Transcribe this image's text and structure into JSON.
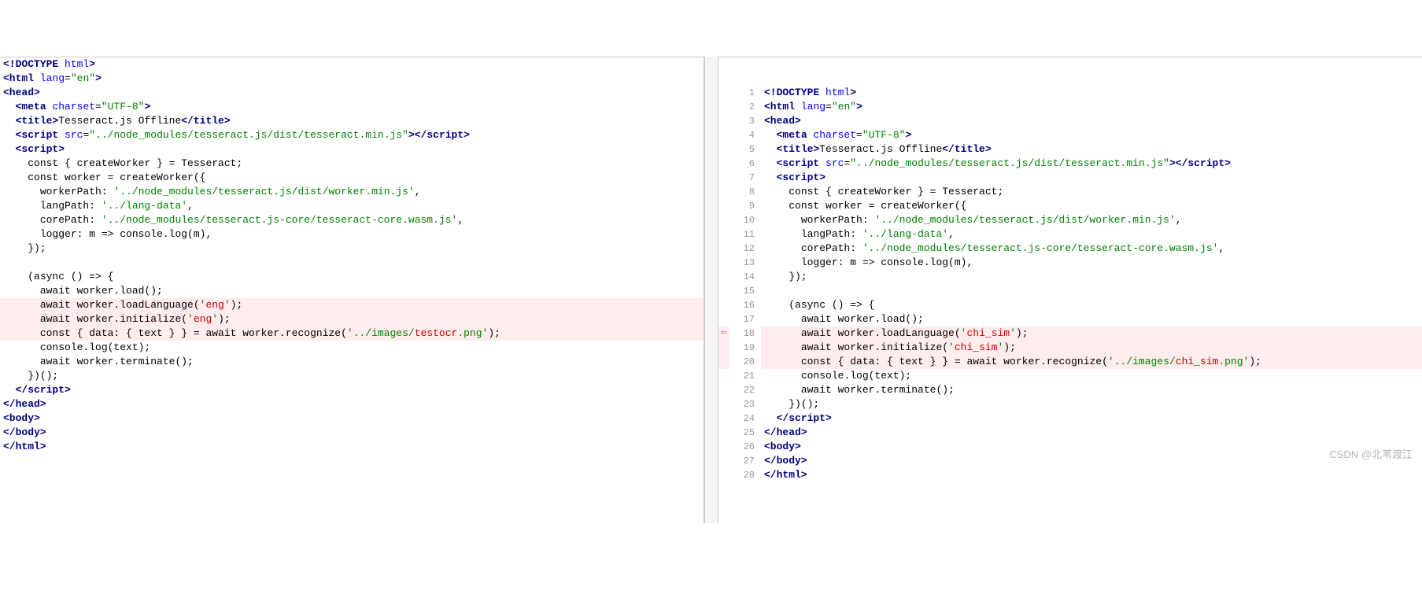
{
  "watermark": "CSDN @北苇渡江",
  "left": {
    "lines": [
      {
        "diff": false,
        "tokens": [
          {
            "t": "<!DOCTYPE ",
            "c": "tag"
          },
          {
            "t": "html",
            "c": "attr"
          },
          {
            "t": ">",
            "c": "tag"
          }
        ]
      },
      {
        "diff": false,
        "tokens": [
          {
            "t": "<html ",
            "c": "tag"
          },
          {
            "t": "lang",
            "c": "attr"
          },
          {
            "t": "=",
            "c": ""
          },
          {
            "t": "\"en\"",
            "c": "str"
          },
          {
            "t": ">",
            "c": "tag"
          }
        ]
      },
      {
        "diff": false,
        "tokens": [
          {
            "t": "<head>",
            "c": "tag"
          }
        ]
      },
      {
        "diff": false,
        "indent": 1,
        "tokens": [
          {
            "t": "<meta ",
            "c": "tag"
          },
          {
            "t": "charset",
            "c": "attr"
          },
          {
            "t": "=",
            "c": ""
          },
          {
            "t": "\"UTF-8\"",
            "c": "str"
          },
          {
            "t": ">",
            "c": "tag"
          }
        ]
      },
      {
        "diff": false,
        "indent": 1,
        "tokens": [
          {
            "t": "<title>",
            "c": "tag"
          },
          {
            "t": "Tesseract.js Offline",
            "c": ""
          },
          {
            "t": "</title>",
            "c": "tag"
          }
        ]
      },
      {
        "diff": false,
        "indent": 1,
        "tokens": [
          {
            "t": "<script ",
            "c": "tag"
          },
          {
            "t": "src",
            "c": "attr"
          },
          {
            "t": "=",
            "c": ""
          },
          {
            "t": "\"../node_modules/tesseract.js/dist/tesseract.min.js\"",
            "c": "str"
          },
          {
            "t": ">",
            "c": "tag"
          },
          {
            "t": "</script>",
            "c": "tag"
          }
        ]
      },
      {
        "diff": false,
        "indent": 1,
        "tokens": [
          {
            "t": "<script>",
            "c": "tag"
          }
        ]
      },
      {
        "diff": false,
        "indent": 2,
        "tokens": [
          {
            "t": "const { createWorker } = Tesseract;",
            "c": ""
          }
        ]
      },
      {
        "diff": false,
        "indent": 2,
        "tokens": [
          {
            "t": "const worker = createWorker({",
            "c": ""
          }
        ]
      },
      {
        "diff": false,
        "indent": 3,
        "tokens": [
          {
            "t": "workerPath: ",
            "c": ""
          },
          {
            "t": "'../node_modules/tesseract.js/dist/worker.min.js'",
            "c": "str"
          },
          {
            "t": ",",
            "c": ""
          }
        ]
      },
      {
        "diff": false,
        "indent": 3,
        "tokens": [
          {
            "t": "langPath: ",
            "c": ""
          },
          {
            "t": "'../lang-data'",
            "c": "str"
          },
          {
            "t": ",",
            "c": ""
          }
        ]
      },
      {
        "diff": false,
        "indent": 3,
        "tokens": [
          {
            "t": "corePath: ",
            "c": ""
          },
          {
            "t": "'../node_modules/tesseract.js-core/tesseract-core.wasm.js'",
            "c": "str"
          },
          {
            "t": ",",
            "c": ""
          }
        ]
      },
      {
        "diff": false,
        "indent": 3,
        "tokens": [
          {
            "t": "logger: m => console.log(m),",
            "c": ""
          }
        ]
      },
      {
        "diff": false,
        "indent": 2,
        "tokens": [
          {
            "t": "});",
            "c": ""
          }
        ]
      },
      {
        "diff": false,
        "indent": 0,
        "tokens": [
          {
            "t": "",
            "c": ""
          }
        ]
      },
      {
        "diff": false,
        "indent": 2,
        "tokens": [
          {
            "t": "(async () => {",
            "c": ""
          }
        ]
      },
      {
        "diff": false,
        "indent": 3,
        "tokens": [
          {
            "t": "await worker.load();",
            "c": ""
          }
        ]
      },
      {
        "diff": true,
        "indent": 3,
        "tokens": [
          {
            "t": "await worker.loadLanguage(",
            "c": ""
          },
          {
            "t": "'",
            "c": "str"
          },
          {
            "t": "eng",
            "c": "red"
          },
          {
            "t": "'",
            "c": "str"
          },
          {
            "t": ");",
            "c": ""
          }
        ]
      },
      {
        "diff": true,
        "indent": 3,
        "tokens": [
          {
            "t": "await worker.initialize(",
            "c": ""
          },
          {
            "t": "'",
            "c": "str"
          },
          {
            "t": "eng",
            "c": "red"
          },
          {
            "t": "'",
            "c": "str"
          },
          {
            "t": ");",
            "c": ""
          }
        ]
      },
      {
        "diff": true,
        "indent": 3,
        "tokens": [
          {
            "t": "const { data: { text } } = await worker.recognize(",
            "c": ""
          },
          {
            "t": "'../images/",
            "c": "str"
          },
          {
            "t": "testocr",
            "c": "red"
          },
          {
            "t": ".png'",
            "c": "str"
          },
          {
            "t": ");",
            "c": ""
          }
        ]
      },
      {
        "diff": false,
        "indent": 3,
        "tokens": [
          {
            "t": "console.log(text);",
            "c": ""
          }
        ]
      },
      {
        "diff": false,
        "indent": 3,
        "tokens": [
          {
            "t": "await worker.terminate();",
            "c": ""
          }
        ]
      },
      {
        "diff": false,
        "indent": 2,
        "tokens": [
          {
            "t": "})();",
            "c": ""
          }
        ]
      },
      {
        "diff": false,
        "indent": 1,
        "tokens": [
          {
            "t": "</script>",
            "c": "tag"
          }
        ]
      },
      {
        "diff": false,
        "tokens": [
          {
            "t": "</head>",
            "c": "tag"
          }
        ]
      },
      {
        "diff": false,
        "tokens": [
          {
            "t": "<body>",
            "c": "tag"
          }
        ]
      },
      {
        "diff": false,
        "tokens": [
          {
            "t": "</body>",
            "c": "tag"
          }
        ]
      },
      {
        "diff": false,
        "tokens": [
          {
            "t": "</html>",
            "c": "tag"
          }
        ]
      }
    ]
  },
  "right": {
    "lines": [
      {
        "n": 1,
        "diff": false,
        "tokens": [
          {
            "t": "<!DOCTYPE ",
            "c": "tag"
          },
          {
            "t": "html",
            "c": "attr"
          },
          {
            "t": ">",
            "c": "tag"
          }
        ]
      },
      {
        "n": 2,
        "diff": false,
        "tokens": [
          {
            "t": "<html ",
            "c": "tag"
          },
          {
            "t": "lang",
            "c": "attr"
          },
          {
            "t": "=",
            "c": ""
          },
          {
            "t": "\"en\"",
            "c": "str"
          },
          {
            "t": ">",
            "c": "tag"
          }
        ]
      },
      {
        "n": 3,
        "diff": false,
        "tokens": [
          {
            "t": "<head>",
            "c": "tag"
          }
        ]
      },
      {
        "n": 4,
        "diff": false,
        "indent": 1,
        "tokens": [
          {
            "t": "<meta ",
            "c": "tag"
          },
          {
            "t": "charset",
            "c": "attr"
          },
          {
            "t": "=",
            "c": ""
          },
          {
            "t": "\"UTF-8\"",
            "c": "str"
          },
          {
            "t": ">",
            "c": "tag"
          }
        ]
      },
      {
        "n": 5,
        "diff": false,
        "indent": 1,
        "tokens": [
          {
            "t": "<title>",
            "c": "tag"
          },
          {
            "t": "Tesseract.js Offline",
            "c": ""
          },
          {
            "t": "</title>",
            "c": "tag"
          }
        ]
      },
      {
        "n": 6,
        "diff": false,
        "indent": 1,
        "tokens": [
          {
            "t": "<script ",
            "c": "tag"
          },
          {
            "t": "src",
            "c": "attr"
          },
          {
            "t": "=",
            "c": ""
          },
          {
            "t": "\"../node_modules/tesseract.js/dist/tesseract.min.js\"",
            "c": "str"
          },
          {
            "t": ">",
            "c": "tag"
          },
          {
            "t": "</script>",
            "c": "tag"
          }
        ]
      },
      {
        "n": 7,
        "diff": false,
        "indent": 1,
        "tokens": [
          {
            "t": "<script>",
            "c": "tag"
          }
        ]
      },
      {
        "n": 8,
        "diff": false,
        "indent": 2,
        "tokens": [
          {
            "t": "const { createWorker } = Tesseract;",
            "c": ""
          }
        ]
      },
      {
        "n": 9,
        "diff": false,
        "indent": 2,
        "tokens": [
          {
            "t": "const worker = createWorker({",
            "c": ""
          }
        ]
      },
      {
        "n": 10,
        "diff": false,
        "indent": 3,
        "tokens": [
          {
            "t": "workerPath: ",
            "c": ""
          },
          {
            "t": "'../node_modules/tesseract.js/dist/worker.min.js'",
            "c": "str"
          },
          {
            "t": ",",
            "c": ""
          }
        ]
      },
      {
        "n": 11,
        "diff": false,
        "indent": 3,
        "tokens": [
          {
            "t": "langPath: ",
            "c": ""
          },
          {
            "t": "'../lang-data'",
            "c": "str"
          },
          {
            "t": ",",
            "c": ""
          }
        ]
      },
      {
        "n": 12,
        "diff": false,
        "indent": 3,
        "tokens": [
          {
            "t": "corePath: ",
            "c": ""
          },
          {
            "t": "'../node_modules/tesseract.js-core/tesseract-core.wasm.js'",
            "c": "str"
          },
          {
            "t": ",",
            "c": ""
          }
        ]
      },
      {
        "n": 13,
        "diff": false,
        "indent": 3,
        "tokens": [
          {
            "t": "logger: m => console.log(m),",
            "c": ""
          }
        ]
      },
      {
        "n": 14,
        "diff": false,
        "indent": 2,
        "tokens": [
          {
            "t": "});",
            "c": ""
          }
        ]
      },
      {
        "n": 15,
        "diff": false,
        "indent": 0,
        "tokens": [
          {
            "t": "",
            "c": ""
          }
        ]
      },
      {
        "n": 16,
        "diff": false,
        "indent": 2,
        "tokens": [
          {
            "t": "(async () => {",
            "c": ""
          }
        ]
      },
      {
        "n": 17,
        "diff": false,
        "indent": 3,
        "tokens": [
          {
            "t": "await worker.load();",
            "c": ""
          }
        ]
      },
      {
        "n": 18,
        "diff": true,
        "marker": "⇐",
        "indent": 3,
        "tokens": [
          {
            "t": "await worker.loadLanguage(",
            "c": ""
          },
          {
            "t": "'",
            "c": "str"
          },
          {
            "t": "chi_sim",
            "c": "red"
          },
          {
            "t": "'",
            "c": "str"
          },
          {
            "t": ");",
            "c": ""
          }
        ]
      },
      {
        "n": 19,
        "diff": true,
        "indent": 3,
        "tokens": [
          {
            "t": "await worker.initialize(",
            "c": ""
          },
          {
            "t": "'",
            "c": "str"
          },
          {
            "t": "chi_sim",
            "c": "red"
          },
          {
            "t": "'",
            "c": "str"
          },
          {
            "t": ");",
            "c": ""
          }
        ]
      },
      {
        "n": 20,
        "diff": true,
        "indent": 3,
        "tokens": [
          {
            "t": "const { data: { text } } = await worker.recognize(",
            "c": ""
          },
          {
            "t": "'../images/",
            "c": "str"
          },
          {
            "t": "chi_sim",
            "c": "red"
          },
          {
            "t": ".png'",
            "c": "str"
          },
          {
            "t": ");",
            "c": ""
          }
        ]
      },
      {
        "n": 21,
        "diff": false,
        "indent": 3,
        "tokens": [
          {
            "t": "console.log(text);",
            "c": ""
          }
        ]
      },
      {
        "n": 22,
        "diff": false,
        "indent": 3,
        "tokens": [
          {
            "t": "await worker.terminate();",
            "c": ""
          }
        ]
      },
      {
        "n": 23,
        "diff": false,
        "indent": 2,
        "tokens": [
          {
            "t": "})();",
            "c": ""
          }
        ]
      },
      {
        "n": 24,
        "diff": false,
        "indent": 1,
        "tokens": [
          {
            "t": "</script>",
            "c": "tag"
          }
        ]
      },
      {
        "n": 25,
        "diff": false,
        "tokens": [
          {
            "t": "</head>",
            "c": "tag"
          }
        ]
      },
      {
        "n": 26,
        "diff": false,
        "tokens": [
          {
            "t": "<body>",
            "c": "tag"
          }
        ]
      },
      {
        "n": 27,
        "diff": false,
        "tokens": [
          {
            "t": "</body>",
            "c": "tag"
          }
        ]
      },
      {
        "n": 28,
        "diff": false,
        "tokens": [
          {
            "t": "</html>",
            "c": "tag"
          }
        ]
      }
    ]
  }
}
